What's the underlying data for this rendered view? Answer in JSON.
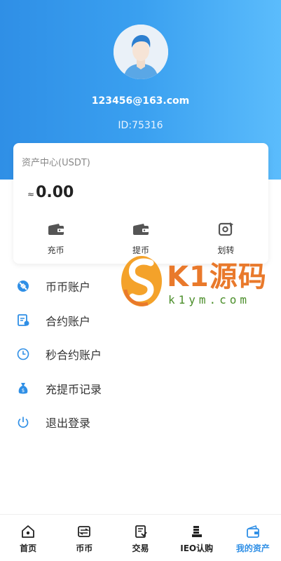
{
  "profile": {
    "email": "123456@163.com",
    "id_text": "ID:75316"
  },
  "asset_card": {
    "title": "资产中心(USDT)",
    "approx_symbol": "≈",
    "balance": "0.00",
    "actions": [
      {
        "label": "充币",
        "icon": "wallet-icon"
      },
      {
        "label": "提币",
        "icon": "wallet-icon"
      },
      {
        "label": "划转",
        "icon": "transfer-icon"
      }
    ]
  },
  "menu": [
    {
      "label": "币币账户",
      "icon": "coin-account-icon"
    },
    {
      "label": "合约账户",
      "icon": "contract-icon"
    },
    {
      "label": "秒合约账户",
      "icon": "clock-icon"
    },
    {
      "label": "充提币记录",
      "icon": "money-bag-icon"
    },
    {
      "label": "退出登录",
      "icon": "power-icon"
    }
  ],
  "watermark": {
    "brand": "K1源码",
    "site": "k1ym.com"
  },
  "tabbar": [
    {
      "label": "首页",
      "icon": "home-icon"
    },
    {
      "label": "币币",
      "icon": "exchange-icon"
    },
    {
      "label": "交易",
      "icon": "trade-icon"
    },
    {
      "label": "IEO认购",
      "icon": "ieo-icon"
    },
    {
      "label": "我的资产",
      "icon": "assets-wallet-icon",
      "active": true
    }
  ],
  "colors": {
    "accent": "#2f8fe6",
    "header_start": "#2f8fe6",
    "header_end": "#5bbcfc",
    "watermark_orange": "#e9792b",
    "watermark_green": "#4b8e2a"
  }
}
